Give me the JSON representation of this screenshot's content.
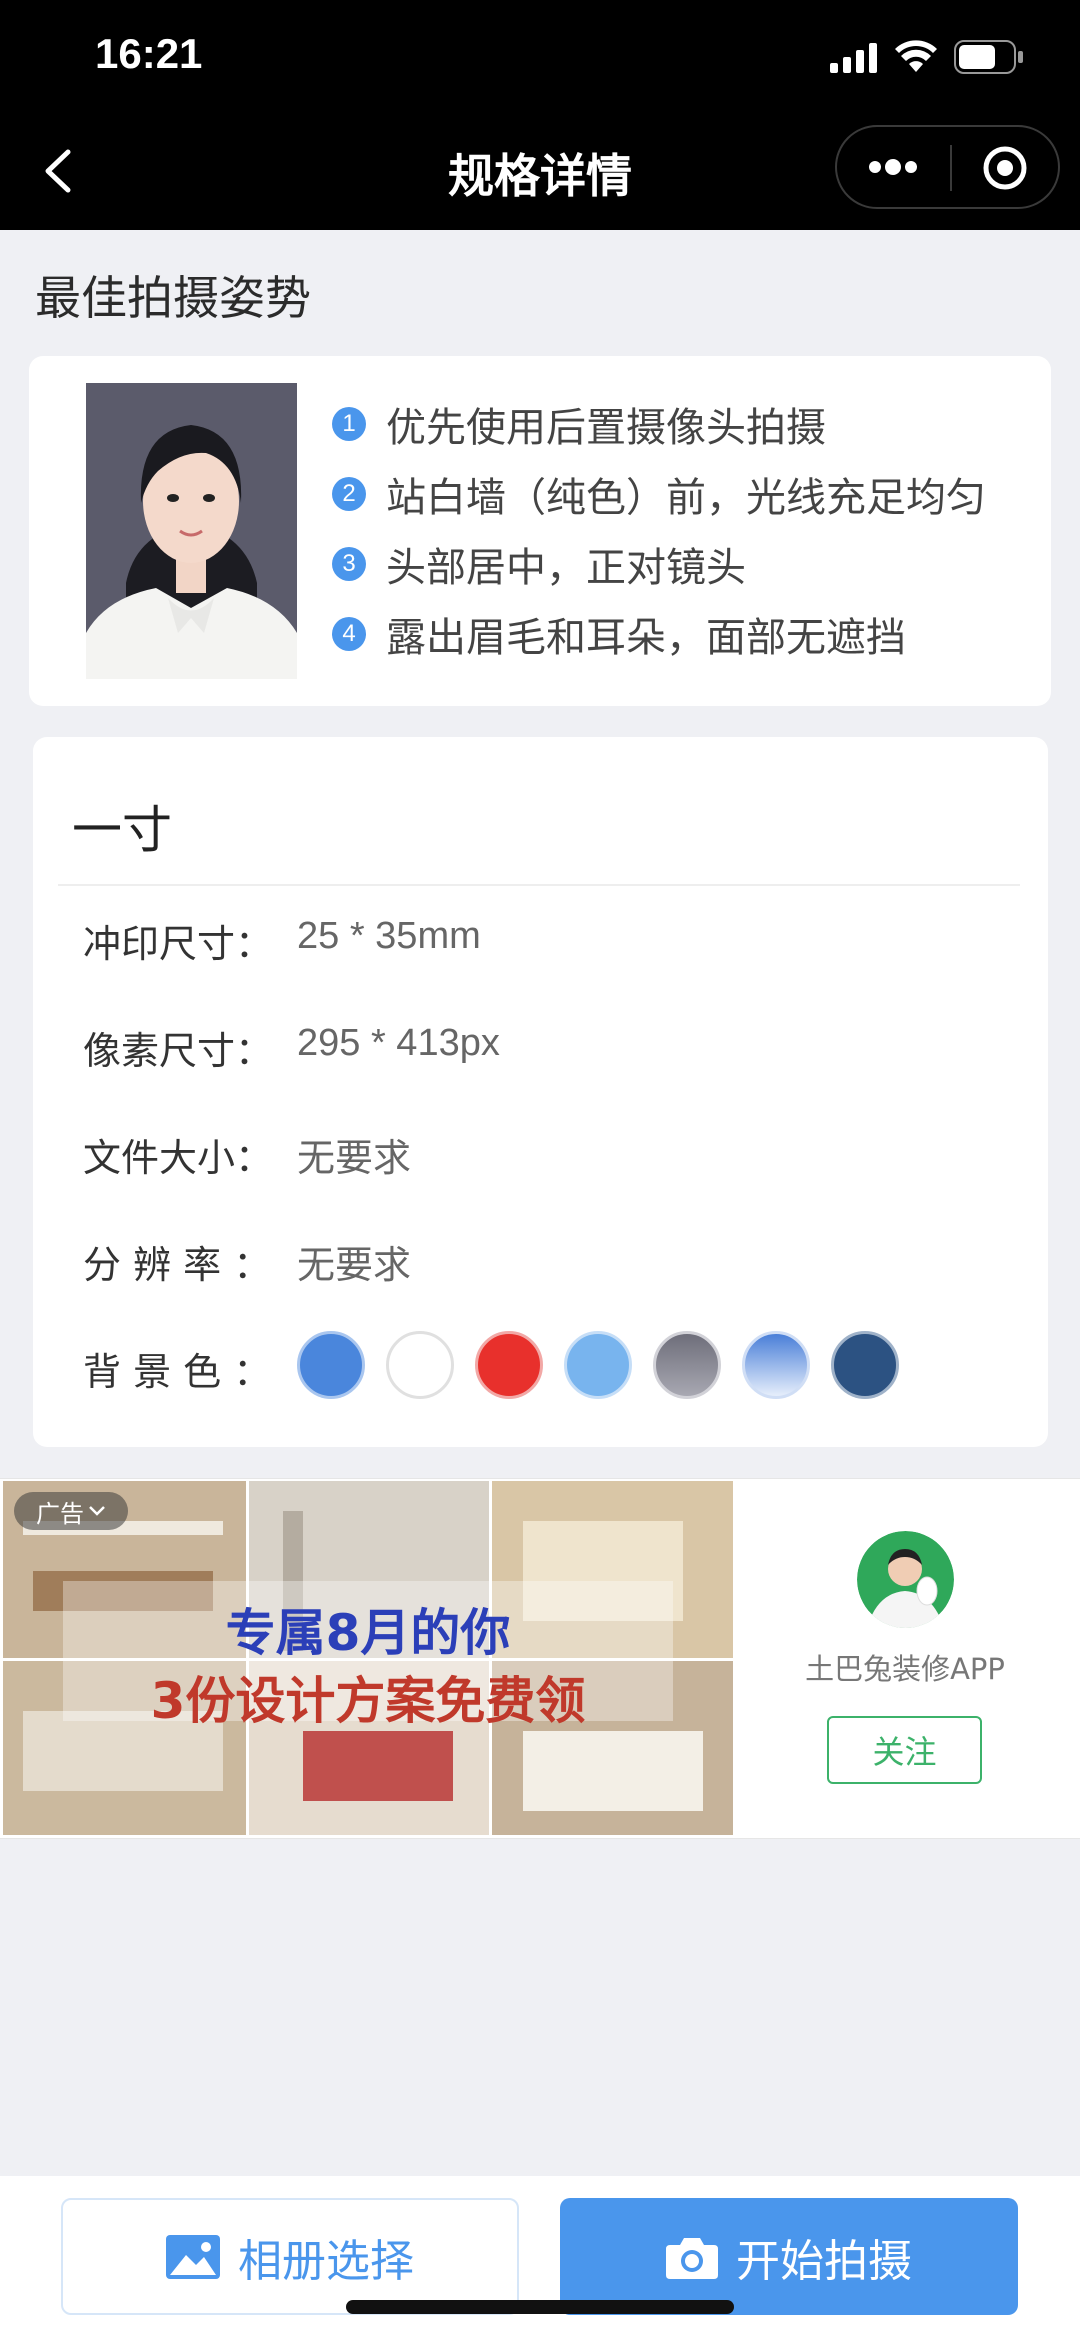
{
  "status_bar": {
    "time": "16:21"
  },
  "nav": {
    "title": "规格详情"
  },
  "pose": {
    "section_title": "最佳拍摄姿势",
    "tips": [
      {
        "num": "1",
        "text": "优先使用后置摄像头拍摄"
      },
      {
        "num": "2",
        "text": "站白墙（纯色）前，光线充足均匀"
      },
      {
        "num": "3",
        "text": "头部居中，正对镜头"
      },
      {
        "num": "4",
        "text": "露出眉毛和耳朵，面部无遮挡"
      }
    ]
  },
  "spec": {
    "title": "一寸",
    "rows": [
      {
        "label": "冲印尺寸：",
        "value": "25 * 35mm"
      },
      {
        "label": "像素尺寸：",
        "value": "295 * 413px"
      },
      {
        "label": "文件大小：",
        "value": "无要求"
      },
      {
        "label": "分 辨 率 ：",
        "value": "无要求"
      }
    ],
    "bg_label": "背 景 色 ：",
    "bg_colors": [
      "#4a86dc",
      "#ffffff",
      "#e8302c",
      "#78b4ee",
      "#8a8a96",
      "gradient-light-blue",
      "#2c5282"
    ]
  },
  "ad": {
    "tag": "广告",
    "image_line1": "专属8月的你",
    "image_line2": "3份设计方案免费领",
    "advertiser": "土巴兔装修APP",
    "follow_label": "关注"
  },
  "actions": {
    "album_label": "相册选择",
    "shoot_label": "开始拍摄"
  }
}
